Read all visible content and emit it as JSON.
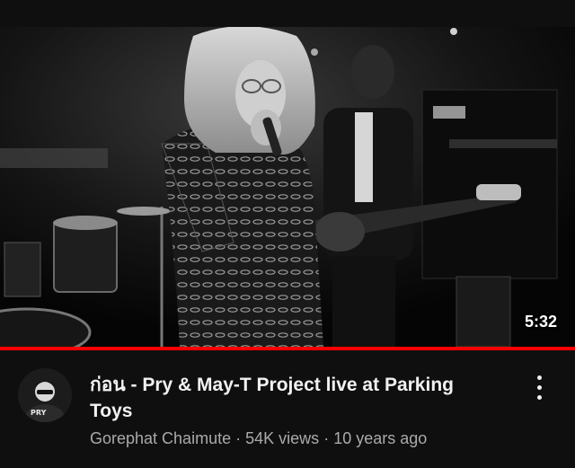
{
  "video": {
    "duration": "5:32",
    "progress_fraction": 1.0,
    "progress_color": "#ff0000"
  },
  "details": {
    "title": "ก่อน - Pry & May-T Project live at Parking Toys",
    "channel": "Gorephat Chaimute",
    "separator": "·",
    "views": "54K views",
    "age": "10 years ago",
    "avatar_text": "PRY"
  },
  "icons": {
    "menu": "more-vertical-icon"
  }
}
